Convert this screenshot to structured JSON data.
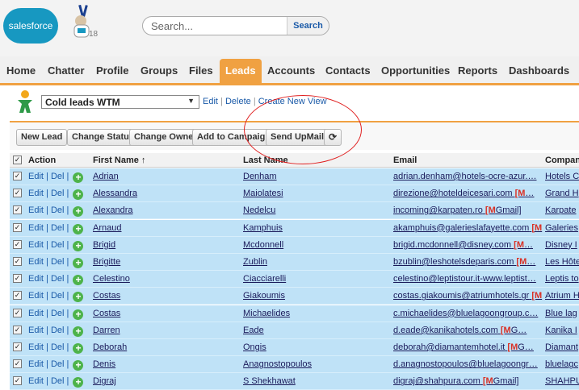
{
  "header": {
    "logo_text": "salesforce",
    "mascot_icon": "astro-mascot",
    "mascot_badge": "18",
    "search": {
      "placeholder": "Search...",
      "button_label": "Search"
    }
  },
  "nav": {
    "tabs": [
      {
        "label": "Home"
      },
      {
        "label": "Chatter"
      },
      {
        "label": "Profile"
      },
      {
        "label": "Groups"
      },
      {
        "label": "Files"
      },
      {
        "label": "Leads",
        "active": true
      },
      {
        "label": "Accounts"
      },
      {
        "label": "Contacts"
      },
      {
        "label": "Opportunities"
      },
      {
        "label": "Reports"
      },
      {
        "label": "Dashboards"
      }
    ],
    "accent_color": "#f0a142"
  },
  "view": {
    "icon": "leads-person-icon",
    "selected": "Cold leads WTM",
    "edit_label": "Edit",
    "delete_label": "Delete",
    "create_label": "Create New View"
  },
  "toolbar": {
    "buttons": [
      "New Lead",
      "Change Status",
      "Change Owner",
      "Add to Campaign",
      "Send UpMail"
    ],
    "refresh_icon": "refresh-icon"
  },
  "table": {
    "columns": [
      "Action",
      "First Name ↑",
      "Last Name",
      "Email",
      "Company"
    ],
    "action_edit": "Edit",
    "action_del": "Del",
    "rows": [
      {
        "first": "Adrian",
        "last": "Denham",
        "email": "adrian.denham@hotels-ocre-azur.…",
        "company": "Hotels C"
      },
      {
        "first": "Alessandra",
        "last": "Maiolatesi",
        "email": "direzione@hoteldeicesari.com",
        "gmail": "[M",
        "gmail_label": "…",
        "company": "Grand H"
      },
      {
        "first": "Alexandra",
        "last": "Nedelcu",
        "email": "incoming@karpaten.ro",
        "gmail": "[M",
        "gmail_label": "Gmail]",
        "company": "Karpate"
      },
      {
        "first": "Arnaud",
        "last": "Kamphuis",
        "email": "akamphuis@galerieslafayette.com",
        "gmail": "[M",
        "gmail_label": "",
        "company": "Galeries"
      },
      {
        "first": "Brigid",
        "last": "Mcdonnell",
        "email": "brigid.mcdonnell@disney.com",
        "gmail": "[M",
        "gmail_label": "…",
        "company": "Disney I"
      },
      {
        "first": "Brigitte",
        "last": "Zublin",
        "email": "bzublin@leshotelsdeparis.com",
        "gmail": "[M",
        "gmail_label": "…",
        "company": "Les Hôte"
      },
      {
        "first": "Celestino",
        "last": "Ciacciarelli",
        "email": "celestino@leptistour.it-www.leptist…",
        "company": "Leptis to"
      },
      {
        "first": "Costas",
        "last": "Giakoumis",
        "email": "costas.giakoumis@atriumhotels.gr",
        "gmail": "[M",
        "gmail_label": "",
        "company": "Atrium H"
      },
      {
        "first": "Costas",
        "last": "Michaelides",
        "email": "c.michaelides@bluelagoongroup.c…",
        "company": "Blue lag"
      },
      {
        "first": "Darren",
        "last": "Eade",
        "email": "d.eade@kanikahotels.com",
        "gmail": "[M",
        "gmail_label": "G…",
        "company": "Kanika I"
      },
      {
        "first": "Deborah",
        "last": "Ongis",
        "email": "deborah@diamantemhotel.it",
        "gmail": "[M",
        "gmail_label": "G…",
        "company": "Diamant"
      },
      {
        "first": "Denis",
        "last": "Anagnostopoulos",
        "email": "d.anagnostopoulos@bluelagoongr…",
        "company": "bluelagc"
      },
      {
        "first": "Digraj",
        "last": "S Shekhawat",
        "email": "digraj@shahpura.com",
        "gmail": "[M",
        "gmail_label": "Gmail]",
        "company": "SHAHPU"
      }
    ]
  },
  "colors": {
    "row_highlight": "#bfe2f7",
    "link": "#1a5aa8",
    "annotation": "#e02020"
  }
}
